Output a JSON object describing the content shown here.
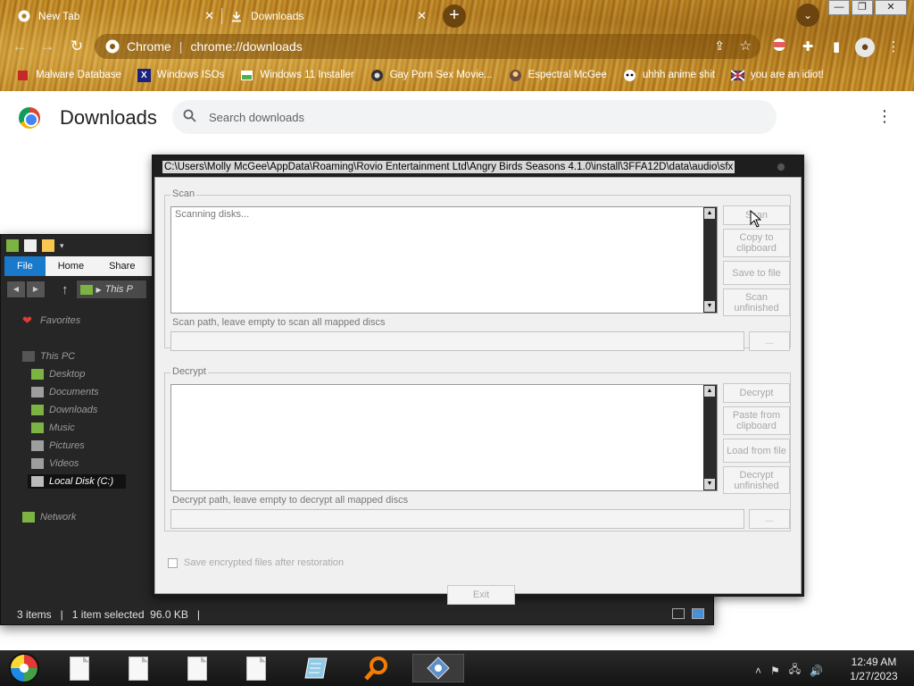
{
  "browser": {
    "tabs": [
      {
        "label": "New Tab"
      },
      {
        "label": "Downloads"
      }
    ],
    "window_controls": {
      "minimize": "—",
      "maximize": "❐",
      "close": "✕"
    },
    "omnibox": {
      "site_name": "Chrome",
      "separator": "|",
      "url": "chrome://downloads"
    },
    "bookmarks": [
      {
        "label": "Malware Database"
      },
      {
        "label": "Windows ISOs"
      },
      {
        "label": "Windows 11 Installer"
      },
      {
        "label": "Gay Porn Sex Movie..."
      },
      {
        "label": "Espectral McGee"
      },
      {
        "label": "uhhh anime shit"
      },
      {
        "label": "you are an idiot!"
      }
    ]
  },
  "downloads_page": {
    "title": "Downloads",
    "search_placeholder": "Search downloads"
  },
  "explorer": {
    "ribbon_tabs": [
      {
        "label": "File"
      },
      {
        "label": "Home"
      },
      {
        "label": "Share"
      }
    ],
    "address": "This P",
    "tree": [
      {
        "label": "Favorites",
        "icon": "heart-icon"
      },
      {
        "label": "This PC",
        "icon": "computer-icon"
      },
      {
        "label": "Desktop",
        "icon": "folder-icon"
      },
      {
        "label": "Documents",
        "icon": "folder-icon"
      },
      {
        "label": "Downloads",
        "icon": "folder-icon"
      },
      {
        "label": "Music",
        "icon": "folder-icon"
      },
      {
        "label": "Pictures",
        "icon": "folder-icon"
      },
      {
        "label": "Videos",
        "icon": "folder-icon"
      },
      {
        "label": "Local Disk (C:)",
        "icon": "drive-icon"
      },
      {
        "label": "Network",
        "icon": "network-icon"
      }
    ],
    "status": "3 items   |   1 item selected  96.0 KB   |"
  },
  "tool": {
    "title": "C:\\Users\\Molly McGee\\AppData\\Roaming\\Rovio Entertainment Ltd\\Angry Birds Seasons 4.1.0\\install\\3FFA12D\\data\\audio\\sfx",
    "scan": {
      "group_label": "Scan",
      "log_text": "Scanning disks...",
      "buttons": {
        "scan": "Scan",
        "copy": "Copy to clipboard",
        "save": "Save to file",
        "unfinished": "Scan unfinished"
      },
      "path_label": "Scan path, leave empty to scan all mapped discs",
      "browse": "..."
    },
    "decrypt": {
      "group_label": "Decrypt",
      "buttons": {
        "decrypt": "Decrypt",
        "paste": "Paste from clipboard",
        "load": "Load from file",
        "unfinished": "Decrypt unfinished"
      },
      "path_label": "Decrypt path, leave empty to decrypt all mapped discs",
      "browse": "..."
    },
    "save_checkbox_label": "Save encrypted files after restoration",
    "exit_label": "Exit"
  },
  "taskbar": {
    "clock_time": "12:49 AM",
    "clock_date": "1/27/2023"
  }
}
